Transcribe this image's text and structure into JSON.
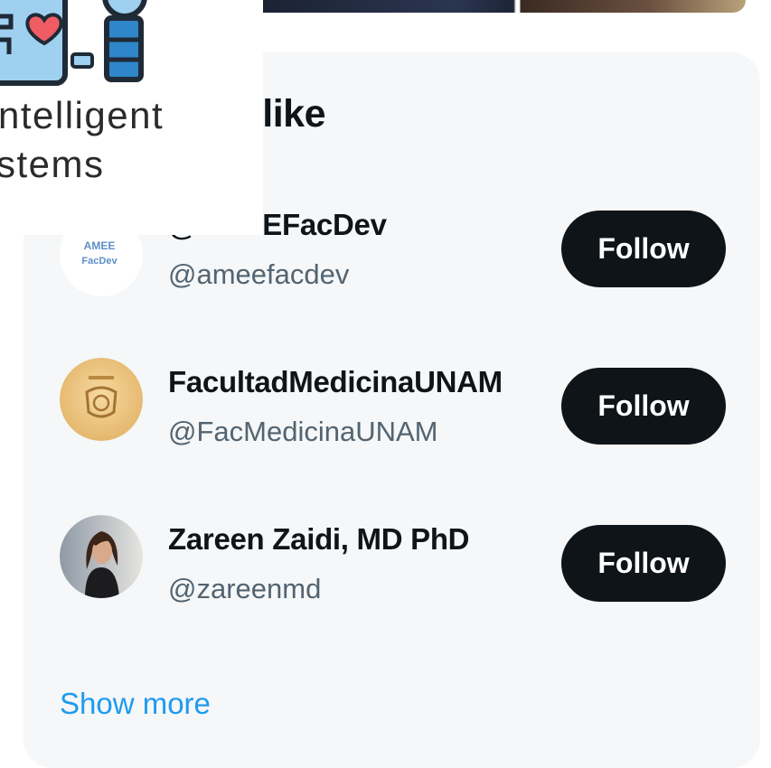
{
  "panel": {
    "title": "t like",
    "show_more": "Show more"
  },
  "suggestions": [
    {
      "name": "@AMEEFacDev",
      "handle": "@ameefacdev",
      "follow_label": "Follow",
      "avatar_text_1": "AMEE",
      "avatar_text_2": "FacDev"
    },
    {
      "name": "FacultadMedicinaUNAM",
      "handle": "@FacMedicinaUNAM",
      "follow_label": "Follow"
    },
    {
      "name": "Zareen Zaidi, MD PhD",
      "handle": "@zareenmd",
      "follow_label": "Follow"
    }
  ],
  "logo": {
    "line1": "ntelligent",
    "line2": "stems"
  },
  "colors": {
    "card_bg": "#f5f7f8",
    "button_bg": "#0f1419",
    "link": "#1d9bf0",
    "secondary_text": "#536471"
  }
}
